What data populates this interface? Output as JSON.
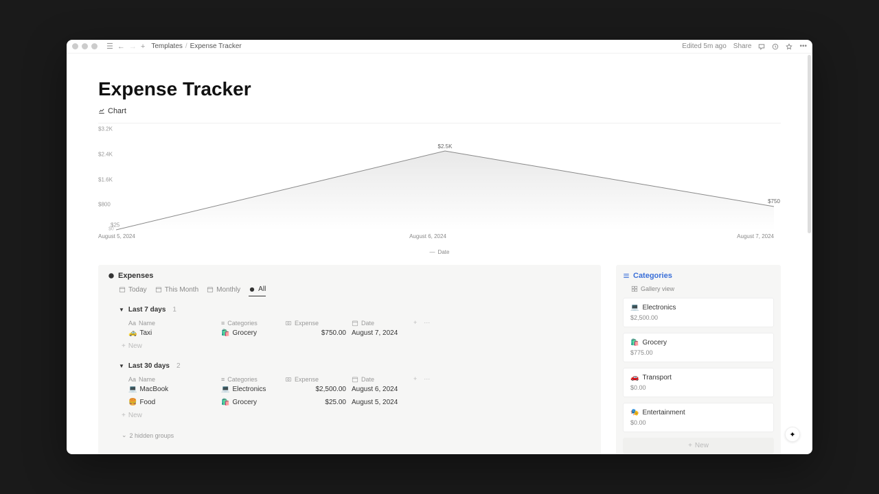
{
  "titlebar": {
    "breadcrumb1": "Templates",
    "breadcrumb2": "Expense Tracker",
    "edited": "Edited 5m ago",
    "share": "Share"
  },
  "page": {
    "title": "Expense Tracker",
    "chart_tab": "Chart"
  },
  "chart_data": {
    "type": "line",
    "title": "",
    "xlabel": "Date",
    "ylabel": "",
    "ylim": [
      0,
      3200
    ],
    "yticks": [
      "$3.2K",
      "$2.4K",
      "$1.6K",
      "$800"
    ],
    "categories": [
      "August 5, 2024",
      "August 6, 2024",
      "August 7, 2024"
    ],
    "values": [
      25,
      2500,
      750
    ],
    "point_labels": [
      "$25",
      "$2.5K",
      "$750"
    ],
    "legend": "Date"
  },
  "expenses": {
    "title": "Expenses",
    "tabs": [
      "Today",
      "This Month",
      "Monthly",
      "All"
    ],
    "active_tab": 3,
    "headers": {
      "name": "Name",
      "categories": "Categories",
      "expense": "Expense",
      "date": "Date"
    },
    "groups": [
      {
        "label": "Last 7 days",
        "count": "1",
        "rows": [
          {
            "icon": "🚕",
            "name": "Taxi",
            "cat_icon": "🛍️",
            "category": "Grocery",
            "expense": "$750.00",
            "date": "August 7, 2024"
          }
        ]
      },
      {
        "label": "Last 30 days",
        "count": "2",
        "rows": [
          {
            "icon": "💻",
            "name": "MacBook",
            "cat_icon": "💻",
            "category": "Electronics",
            "expense": "$2,500.00",
            "date": "August 6, 2024"
          },
          {
            "icon": "🍔",
            "name": "Food",
            "cat_icon": "🛍️",
            "category": "Grocery",
            "expense": "$25.00",
            "date": "August 5, 2024"
          }
        ]
      }
    ],
    "new_label": "New",
    "hidden_groups": "2 hidden groups"
  },
  "categories": {
    "title": "Categories",
    "view_label": "Gallery view",
    "cards": [
      {
        "icon": "💻",
        "name": "Electronics",
        "amount": "$2,500.00"
      },
      {
        "icon": "🛍️",
        "name": "Grocery",
        "amount": "$775.00"
      },
      {
        "icon": "🚗",
        "name": "Transport",
        "amount": "$0.00"
      },
      {
        "icon": "🎭",
        "name": "Entertainment",
        "amount": "$0.00"
      }
    ],
    "new_label": "New"
  }
}
